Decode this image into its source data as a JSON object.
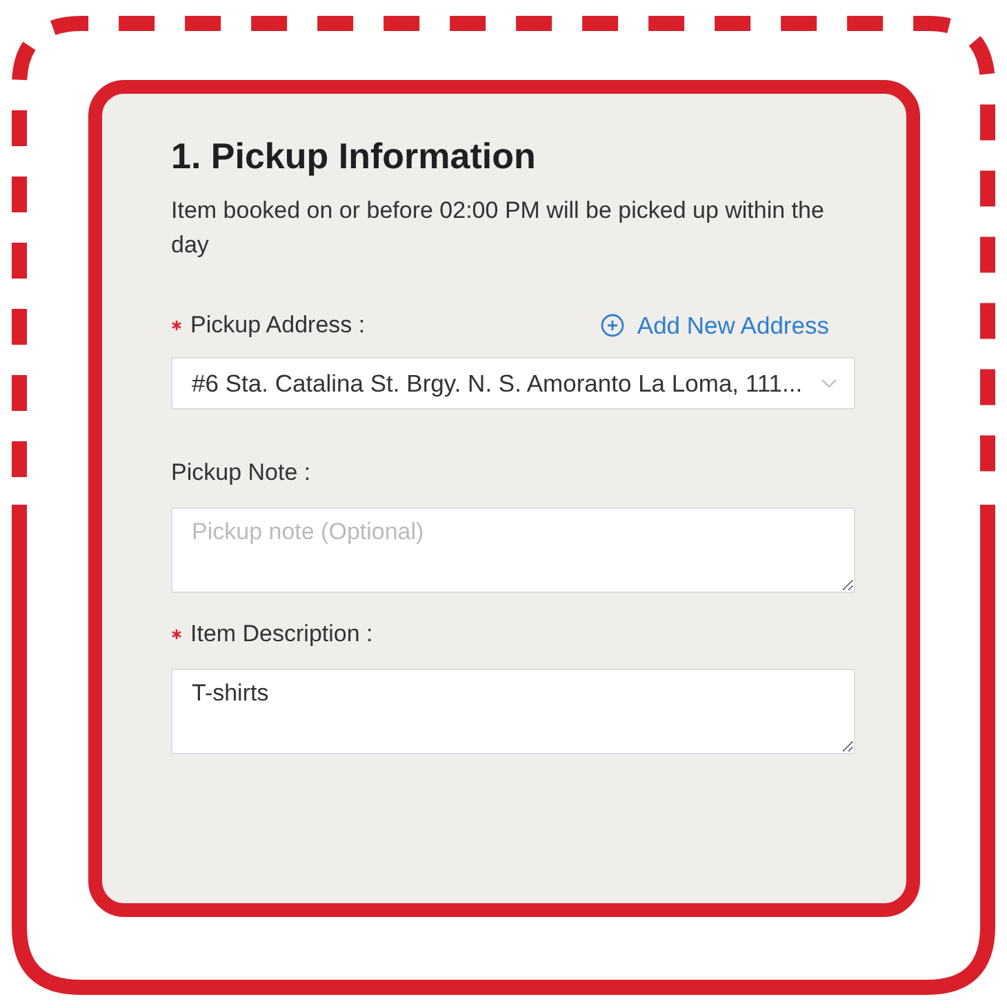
{
  "form": {
    "title": "1. Pickup Information",
    "notice": "Item booked on or before 02:00 PM will be picked up within the day",
    "fields": [
      {
        "kind": "select",
        "label": "Pickup Address :",
        "required": true,
        "value": "#6 Sta. Catalina St. Brgy. N. S. Amoranto La Loma, 111...",
        "link": "Add New Address"
      },
      {
        "kind": "textarea",
        "label": "Pickup Note :",
        "required": false,
        "placeholder": "Pickup note (Optional)"
      },
      {
        "kind": "textarea",
        "label": "Item Description :",
        "required": true,
        "value": "T-shirts"
      }
    ]
  }
}
